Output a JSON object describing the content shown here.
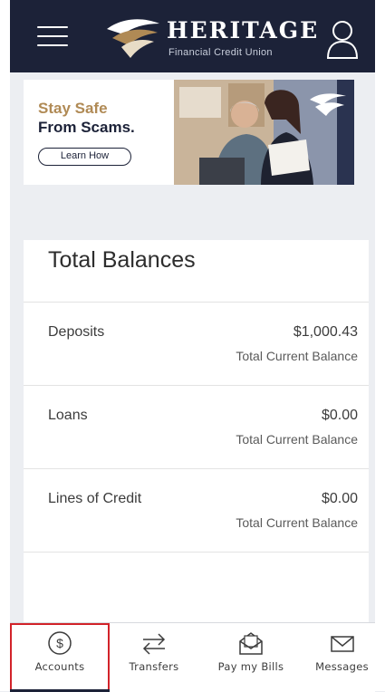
{
  "header": {
    "brand_name": "HERITAGE",
    "brand_subtitle": "Financial Credit Union",
    "menu_icon": "hamburger-icon",
    "profile_icon": "user-icon",
    "bg_color": "#1c2238"
  },
  "banner": {
    "line1": "Stay Safe",
    "line2": "From Scams.",
    "cta": "Learn How",
    "accent_color": "#b08a55"
  },
  "balances": {
    "title": "Total Balances",
    "rows": [
      {
        "label": "Deposits",
        "amount": "$1,000.43",
        "sub": "Total Current Balance"
      },
      {
        "label": "Loans",
        "amount": "$0.00",
        "sub": "Total Current Balance"
      },
      {
        "label": "Lines of Credit",
        "amount": "$0.00",
        "sub": "Total Current Balance"
      }
    ]
  },
  "nav": {
    "items": [
      {
        "label": "Accounts",
        "icon": "dollar-circle-icon",
        "active": true
      },
      {
        "label": "Transfers",
        "icon": "transfer-arrows-icon"
      },
      {
        "label": "Pay my Bills",
        "icon": "bill-envelope-icon"
      },
      {
        "label": "Messages",
        "icon": "mail-icon"
      }
    ],
    "highlight_color": "#d2232a"
  }
}
